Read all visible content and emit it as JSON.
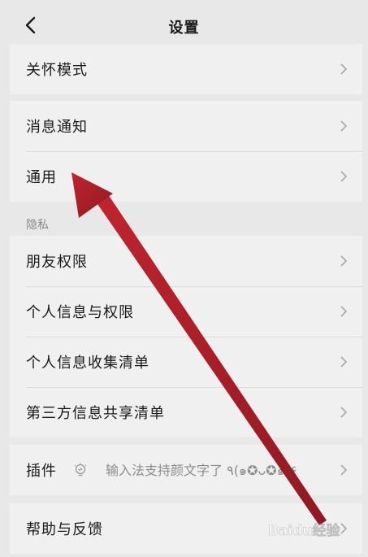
{
  "header": {
    "title": "设置"
  },
  "groups": {
    "care": {
      "items": [
        {
          "label": "关怀模式"
        }
      ]
    },
    "general": {
      "items": [
        {
          "label": "消息通知"
        },
        {
          "label": "通用"
        }
      ]
    },
    "privacy": {
      "section_title": "隐私",
      "items": [
        {
          "label": "朋友权限"
        },
        {
          "label": "个人信息与权限"
        },
        {
          "label": "个人信息收集清单"
        },
        {
          "label": "第三方信息共享清单"
        }
      ]
    },
    "plugins": {
      "items": [
        {
          "label": "插件",
          "extra": "输入法支持颜文字了 ٩(๑✪ᴗ✪๑)۶",
          "icon": "lightbulb-icon"
        }
      ]
    },
    "help": {
      "items": [
        {
          "label": "帮助与反馈"
        }
      ]
    }
  },
  "overlay": {
    "arrow_color": "#b3202a",
    "watermark_text": "Baidu经验"
  }
}
